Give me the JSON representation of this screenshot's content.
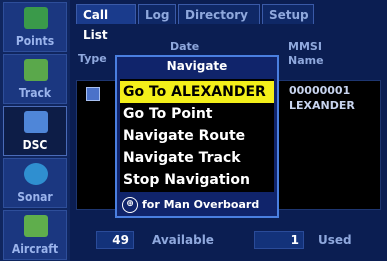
{
  "sidebar": {
    "items": [
      {
        "label": "Points",
        "icon": "points-icon",
        "color": "#3a9a4a"
      },
      {
        "label": "Track",
        "icon": "track-icon",
        "color": "#5aa84b"
      },
      {
        "label": "DSC",
        "icon": "dsc-icon",
        "color": "#4f86d8"
      },
      {
        "label": "Sonar",
        "icon": "sonar-icon",
        "color": "#2f8fd0"
      },
      {
        "label": "Aircraft",
        "icon": "aircraft-icon",
        "color": "#5fae4c"
      }
    ]
  },
  "tabs": [
    "Call List",
    "Log",
    "Directory",
    "Setup"
  ],
  "columns": {
    "type": "Type",
    "date": "Date",
    "mmsi": "MMSI",
    "name": "Name"
  },
  "list": {
    "row": {
      "id": "00000001",
      "name": "LEXANDER"
    }
  },
  "footer": {
    "available_count": "49",
    "available_label": "Available",
    "used_count": "1",
    "used_label": "Used"
  },
  "popup": {
    "title": "Navigate",
    "items": [
      "Go To ALEXANDER",
      "Go To Point",
      "Navigate Route",
      "Navigate Track",
      "Stop Navigation"
    ],
    "selected_index": 0,
    "footer_label": "for Man Overboard",
    "footer_icon": "man-overboard-icon"
  }
}
